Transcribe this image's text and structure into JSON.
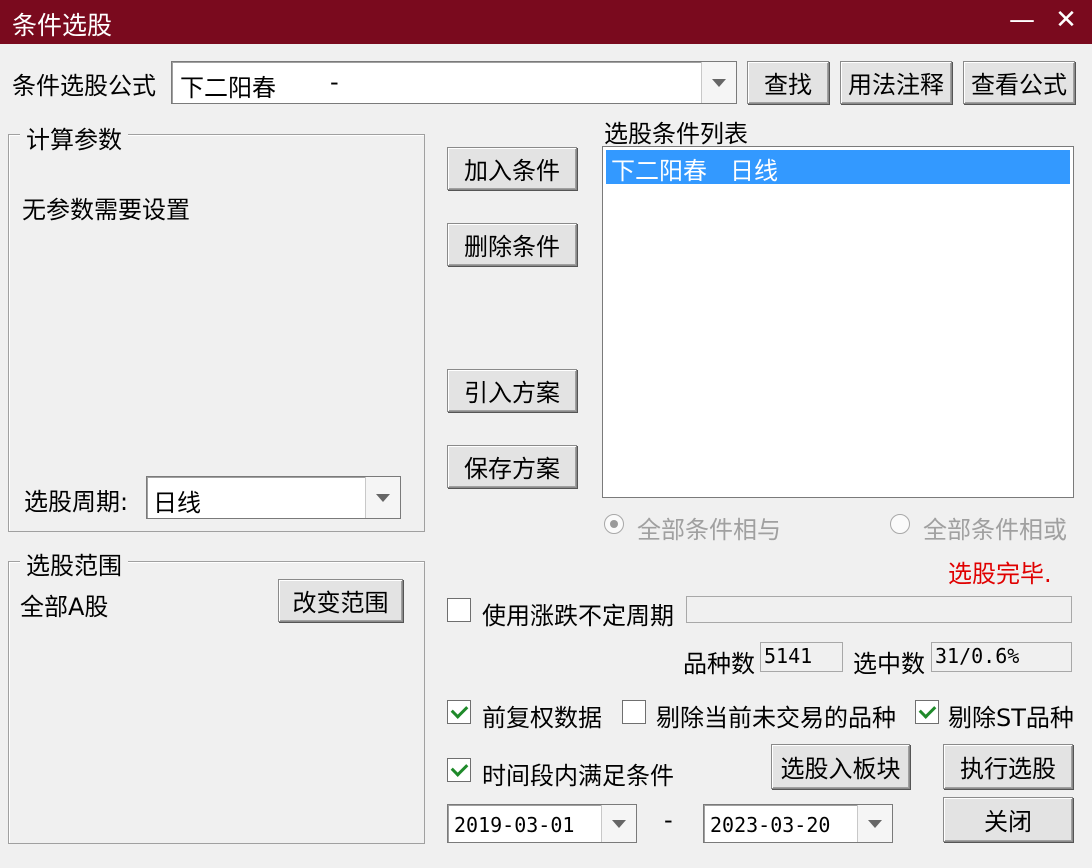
{
  "window": {
    "title": "条件选股",
    "minimize": "—",
    "close": "✕"
  },
  "formula": {
    "label": "条件选股公式",
    "value": "下二阳春",
    "value_suffix": "-"
  },
  "buttons": {
    "find": "查找",
    "usage": "用法注释",
    "view_formula": "查看公式",
    "add_condition": "加入条件",
    "delete_condition": "删除条件",
    "import_plan": "引入方案",
    "save_plan": "保存方案",
    "change_range": "改变范围",
    "to_block": "选股入板块",
    "execute": "执行选股",
    "close": "关闭"
  },
  "params": {
    "group_title": "计算参数",
    "empty_text": "无参数需要设置",
    "period_label": "选股周期:",
    "period_value": "日线"
  },
  "condition_list": {
    "title": "选股条件列表",
    "items": [
      {
        "name": "下二阳春",
        "period": "日线",
        "selected": true
      }
    ]
  },
  "logic": {
    "and_label": "全部条件相与",
    "or_label": "全部条件相或",
    "selected": "and"
  },
  "status": {
    "text": "选股完毕.",
    "color": "#e00000"
  },
  "range": {
    "group_title": "选股范围",
    "value": "全部A股"
  },
  "options": {
    "variable_period": {
      "label": "使用涨跌不定周期",
      "checked": false
    },
    "forward_adjust": {
      "label": "前复权数据",
      "checked": true
    },
    "exclude_untraded": {
      "label": "剔除当前未交易的品种",
      "checked": false
    },
    "exclude_st": {
      "label": "剔除ST品种",
      "checked": true
    },
    "time_range": {
      "label": "时间段内满足条件",
      "checked": true
    }
  },
  "stats": {
    "count_label": "品种数",
    "count_value": "5141",
    "selected_label": "选中数",
    "selected_value": "31/0.6%"
  },
  "dates": {
    "start": "2019-03-01",
    "separator": "-",
    "end": "2023-03-20"
  }
}
